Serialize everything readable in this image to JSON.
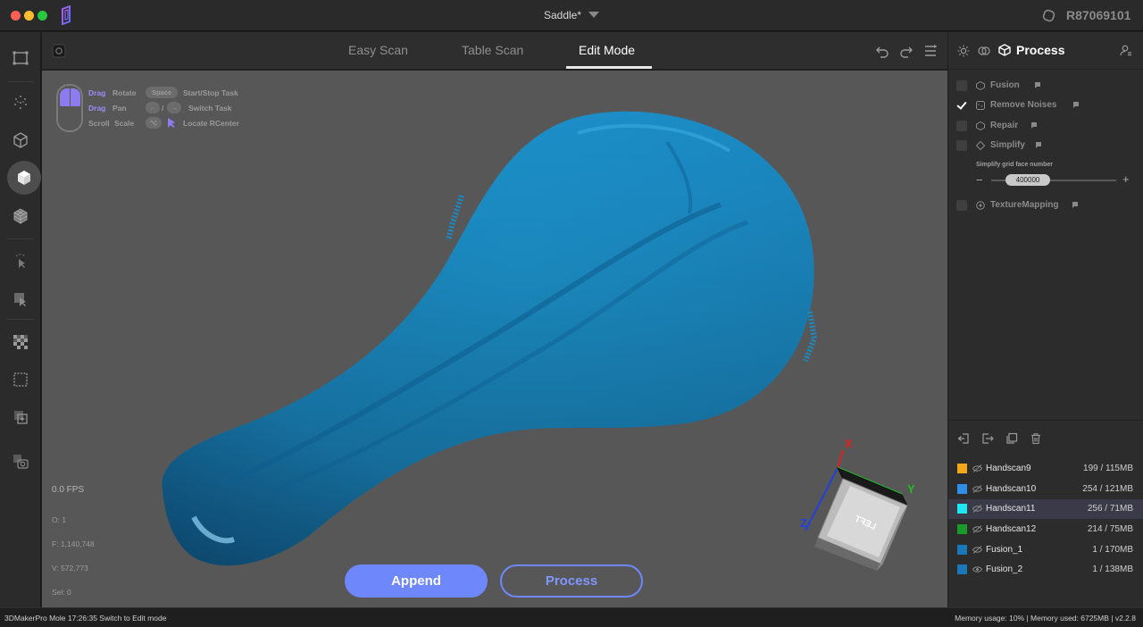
{
  "window": {
    "title": "Saddle*",
    "device_id": "R87069101"
  },
  "tabs": [
    {
      "label": "Easy Scan",
      "active": false
    },
    {
      "label": "Table Scan",
      "active": false
    },
    {
      "label": "Edit Mode",
      "active": true
    }
  ],
  "left_toolbar": {
    "tools": [
      "select-region-icon",
      "point-cloud-icon",
      "wireframe-cube-icon",
      "solid-cube-icon",
      "mesh-cube-icon",
      "pointer-tool-icon",
      "pointer-box-icon",
      "checker-texture-icon",
      "dashed-rect-icon",
      "add-layer-icon",
      "snapshot-icon"
    ],
    "active_index": 3
  },
  "viewport": {
    "hints": {
      "drag_rotate": [
        "Drag",
        "Rotate"
      ],
      "drag_pan": [
        "Drag",
        "Pan"
      ],
      "scroll_scale": [
        "Scroll",
        "Scale"
      ],
      "space_key": "Space",
      "start_stop": "Start/Stop Task",
      "switch_task": "Switch Task",
      "slash": "/",
      "locate": "Locate RCenter"
    },
    "fps": "0.0 FPS",
    "stats": {
      "o": "O: 1",
      "f": "F: 1,140,748",
      "v": "V: 572,773",
      "sel": "Sel: 0"
    },
    "axis_cube": {
      "face_label": "LEFT",
      "x_label": "X",
      "y_label": "Y",
      "z_label": "Z",
      "x_color": "#e02020",
      "y_color": "#20c020",
      "z_color": "#2040e0"
    },
    "model_color": "#1b8fc9",
    "append_label": "Append",
    "process_label": "Process"
  },
  "right_panel": {
    "title": "Process",
    "header_icons": [
      "sun-icon",
      "merge-icon",
      "cube-icon",
      "user-settings-icon"
    ],
    "options": [
      {
        "label": "Fusion",
        "checked": false,
        "icon": "fusion-icon"
      },
      {
        "label": "Remove Noises",
        "checked": true,
        "icon": "noise-icon"
      },
      {
        "label": "Repair",
        "checked": false,
        "icon": "repair-icon"
      },
      {
        "label": "Simplify",
        "checked": false,
        "icon": "simplify-icon"
      },
      {
        "label": "TextureMapping",
        "checked": false,
        "icon": "texture-icon"
      }
    ],
    "simplify": {
      "sublabel": "Simplify grid face number",
      "value": "400000",
      "minus": "−",
      "plus": "+"
    },
    "list_tools": [
      "import-icon",
      "export-icon",
      "duplicate-icon",
      "trash-icon"
    ],
    "scans": [
      {
        "name": "Handscan9",
        "size": "199 / 115MB",
        "color": "#f2a71b",
        "selected": false
      },
      {
        "name": "Handscan10",
        "size": "254 / 121MB",
        "color": "#2f8ee8",
        "selected": false
      },
      {
        "name": "Handscan11",
        "size": "256 / 71MB",
        "color": "#1de8f2",
        "selected": true
      },
      {
        "name": "Handscan12",
        "size": "214 / 75MB",
        "color": "#1a9a2a",
        "selected": false
      },
      {
        "name": "Fusion_1",
        "size": "1 / 170MB",
        "color": "#1a78b8",
        "selected": false
      },
      {
        "name": "Fusion_2",
        "size": "1 / 138MB",
        "color": "#1a78b8",
        "selected": false
      }
    ]
  },
  "statusbar": {
    "left": "3DMakerPro Mole   17:26:35 Switch to Edit mode",
    "right": "Memory usage: 10% | Memory used: 6725MB | v2.2.8"
  }
}
